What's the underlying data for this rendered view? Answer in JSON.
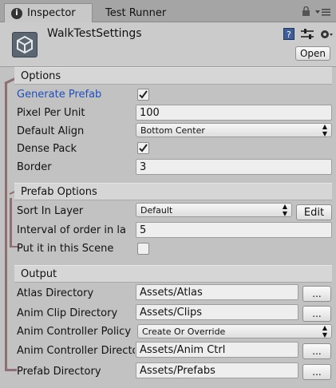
{
  "tabs": {
    "inspector": "Inspector",
    "test_runner": "Test Runner"
  },
  "header": {
    "object_name": "WalkTestSettings",
    "open_button": "Open"
  },
  "options": {
    "title": "Options",
    "generate_prefab_label": "Generate Prefab",
    "generate_prefab_checked": true,
    "pixel_per_unit_label": "Pixel Per Unit",
    "pixel_per_unit_value": "100",
    "default_align_label": "Default Align",
    "default_align_value": "Bottom Center",
    "dense_pack_label": "Dense Pack",
    "dense_pack_checked": true,
    "border_label": "Border",
    "border_value": "3"
  },
  "prefab_options": {
    "title": "Prefab Options",
    "sort_in_layer_label": "Sort In Layer",
    "sort_in_layer_value": "Default",
    "edit_button": "Edit",
    "interval_label": "Interval of order in la",
    "interval_value": "5",
    "put_in_scene_label": "Put it in this Scene",
    "put_in_scene_checked": false
  },
  "output": {
    "title": "Output",
    "atlas_dir_label": "Atlas Directory",
    "atlas_dir_value": "Assets/Atlas",
    "anim_clip_dir_label": "Anim Clip Directory",
    "anim_clip_dir_value": "Assets/Clips",
    "anim_controller_policy_label": "Anim Controller Policy",
    "anim_controller_policy_value": "Create Or Override",
    "anim_controller_dir_label": "Anim Controller Directory",
    "anim_controller_dir_value": "Assets/Anim Ctrl",
    "prefab_dir_label": "Prefab Directory",
    "prefab_dir_value": "Assets/Prefabs",
    "browse_button": "..."
  },
  "colors": {
    "accent_label": "#1f4fbf",
    "bracket": "#8e6f73"
  }
}
